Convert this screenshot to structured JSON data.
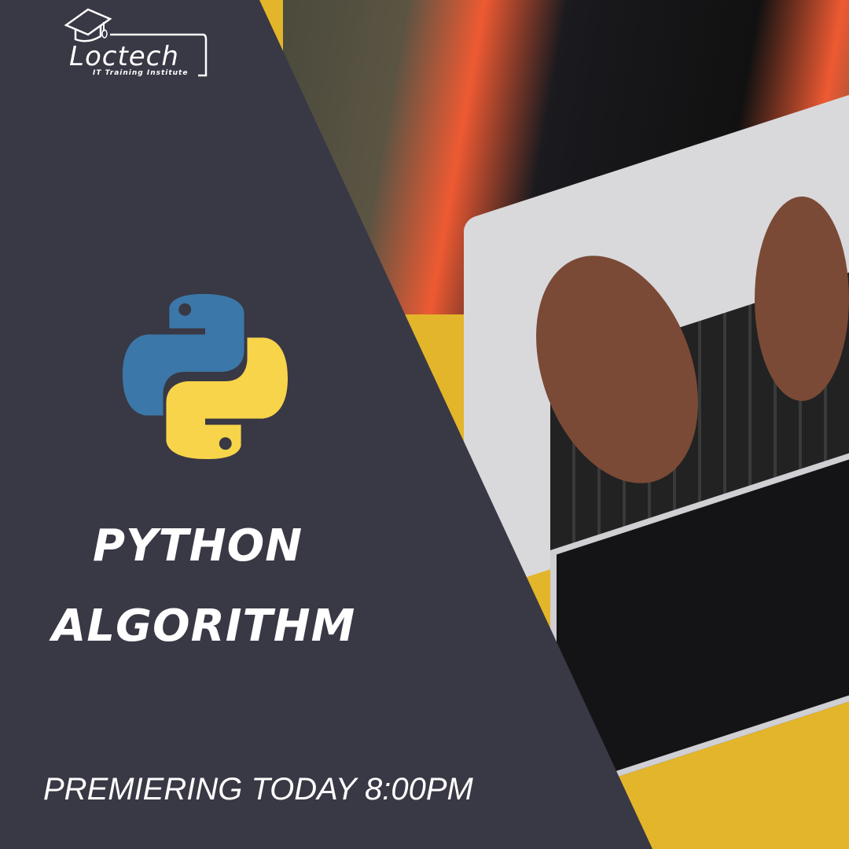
{
  "logo": {
    "name": "Loctech",
    "tagline": "IT Training Institute",
    "icon": "graduation-cap-icon"
  },
  "title": {
    "line1": "PYTHON",
    "line2": "ALGORITHM"
  },
  "premiere": "PREMIERING TODAY 8:00PM",
  "colors": {
    "panel": "#393845",
    "python_blue": "#3b77a8",
    "python_yellow": "#f7d44a",
    "text": "#ffffff"
  }
}
